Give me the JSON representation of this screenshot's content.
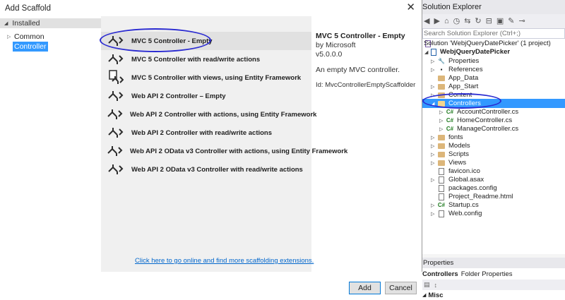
{
  "dialog": {
    "title": "Add Scaffold",
    "close_glyph": "✕",
    "tree": {
      "header": "Installed",
      "items": [
        {
          "label": "Common",
          "selected": false
        },
        {
          "label": "Controller",
          "selected": true
        }
      ]
    },
    "templates": [
      {
        "label": "MVC 5 Controller - Empty",
        "icon": "controller-icon",
        "selected": true
      },
      {
        "label": "MVC 5 Controller with read/write actions",
        "icon": "controller-icon",
        "selected": false
      },
      {
        "label": "MVC 5 Controller with views, using Entity Framework",
        "icon": "controller-views-icon",
        "selected": false
      },
      {
        "label": "Web API 2 Controller – Empty",
        "icon": "controller-icon",
        "selected": false
      },
      {
        "label": "Web API 2 Controller with actions, using Entity Framework",
        "icon": "controller-icon",
        "selected": false
      },
      {
        "label": "Web API 2 Controller with read/write actions",
        "icon": "controller-icon",
        "selected": false
      },
      {
        "label": "Web API 2 OData v3 Controller with actions, using Entity Framework",
        "icon": "controller-icon",
        "selected": false
      },
      {
        "label": "Web API 2 OData v3 Controller with read/write actions",
        "icon": "controller-icon",
        "selected": false
      }
    ],
    "details": {
      "title": "MVC 5 Controller - Empty",
      "author": "by Microsoft",
      "version": "v5.0.0.0",
      "description": "An empty MVC controller.",
      "id": "Id: MvcControllerEmptyScaffolder"
    },
    "online_link": "Click here to go online and find more scaffolding extensions.",
    "buttons": {
      "add": "Add",
      "cancel": "Cancel"
    }
  },
  "solution_explorer": {
    "title": "Solution Explorer",
    "search_placeholder": "Search Solution Explorer (Ctrl+;)",
    "items": [
      {
        "label": "Solution 'WebjQueryDatePicker' (1 project)",
        "icon": "solution-icon"
      },
      {
        "label": "WebjQueryDatePicker",
        "icon": "project-icon",
        "bold": true
      },
      {
        "label": "Properties",
        "icon": "wrench-icon"
      },
      {
        "label": "References",
        "icon": "references-icon"
      },
      {
        "label": "App_Data",
        "icon": "folder-icon"
      },
      {
        "label": "App_Start",
        "icon": "folder-icon"
      },
      {
        "label": "Content",
        "icon": "folder-icon"
      },
      {
        "label": "Controllers",
        "icon": "folder-icon",
        "selected": true
      },
      {
        "label": "AccountController.cs",
        "icon": "csharp-file-icon"
      },
      {
        "label": "HomeController.cs",
        "icon": "csharp-file-icon"
      },
      {
        "label": "ManageController.cs",
        "icon": "csharp-file-icon"
      },
      {
        "label": "fonts",
        "icon": "folder-icon"
      },
      {
        "label": "Models",
        "icon": "folder-icon"
      },
      {
        "label": "Scripts",
        "icon": "folder-icon"
      },
      {
        "label": "Views",
        "icon": "folder-icon"
      },
      {
        "label": "favicon.ico",
        "icon": "file-icon"
      },
      {
        "label": "Global.asax",
        "icon": "file-icon"
      },
      {
        "label": "packages.config",
        "icon": "file-icon"
      },
      {
        "label": "Project_Readme.html",
        "icon": "file-icon"
      },
      {
        "label": "Startup.cs",
        "icon": "csharp-file-icon"
      },
      {
        "label": "Web.config",
        "icon": "file-icon"
      }
    ],
    "properties": {
      "title": "Properties",
      "selected_item": "Controllers",
      "selected_type": "Folder Properties",
      "category": "Misc"
    }
  },
  "colors": {
    "selection": "#3399ff",
    "annotation": "#2b2bd1",
    "link": "#0066cc"
  }
}
